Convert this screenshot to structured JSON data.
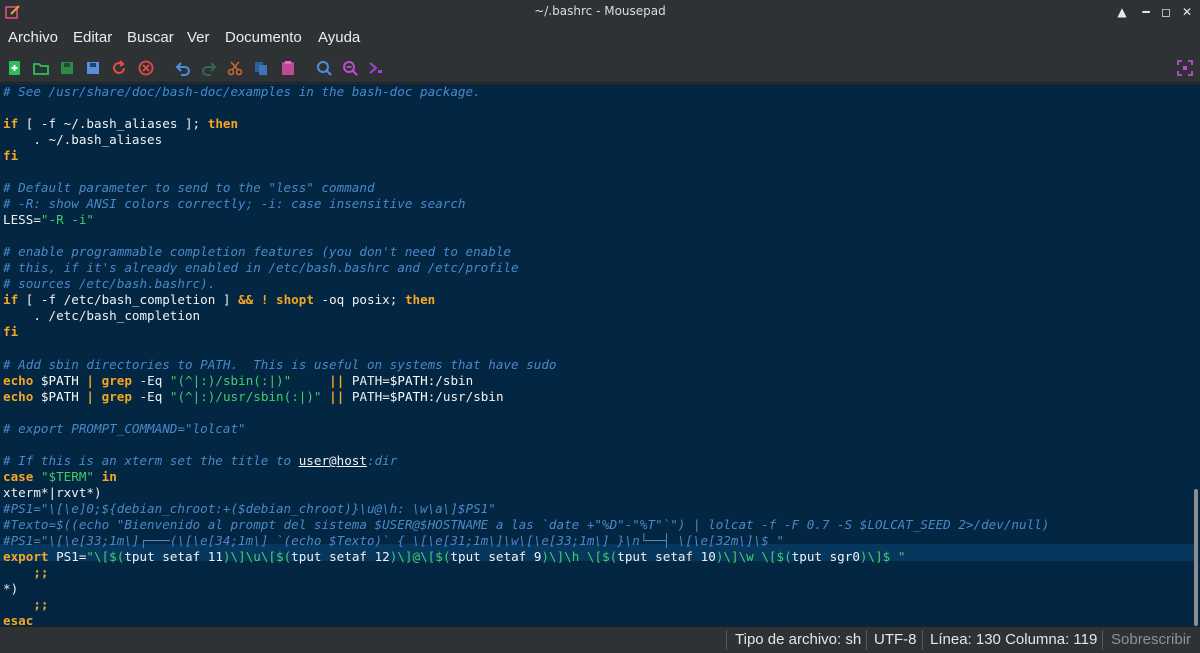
{
  "window": {
    "title": "~/.bashrc - Mousepad",
    "controls": [
      "minimize-up-icon",
      "minimize-icon",
      "maximize-icon",
      "close-icon"
    ]
  },
  "menu": [
    "Archivo",
    "Editar",
    "Buscar",
    "Ver",
    "Documento",
    "Ayuda"
  ],
  "toolbar": {
    "icons": [
      "new-document-icon",
      "open-file-icon",
      "save-icon",
      "save-as-icon",
      "reload-icon",
      "close-document-icon",
      "undo-icon",
      "redo-icon",
      "cut-icon",
      "copy-icon",
      "paste-icon",
      "search-icon",
      "search-replace-icon",
      "go-to-line-icon",
      "fullscreen-icon"
    ]
  },
  "colors": {
    "editor_bg": "#032642",
    "comment": "#4b88c8",
    "keyword": "#f5a623",
    "string": "#3fcf6a",
    "current_line": "#08375d"
  },
  "editor": {
    "lines": [
      {
        "tokens": [
          [
            "cm",
            "# See /usr/share/doc/bash-doc/examples in the bash-doc package."
          ]
        ]
      },
      {
        "tokens": []
      },
      {
        "tokens": [
          [
            "kw",
            "if"
          ],
          [
            "",
            " [ -f ~/.bash_aliases ]; "
          ],
          [
            "kw",
            "then"
          ]
        ]
      },
      {
        "tokens": [
          [
            "",
            "    . ~/.bash_aliases"
          ]
        ]
      },
      {
        "tokens": [
          [
            "kw",
            "fi"
          ]
        ]
      },
      {
        "tokens": []
      },
      {
        "tokens": [
          [
            "cm",
            "# Default parameter to send to the \"less\" command"
          ]
        ]
      },
      {
        "tokens": [
          [
            "cm",
            "# -R: show ANSI colors correctly; -i: case insensitive search"
          ]
        ]
      },
      {
        "tokens": [
          [
            "",
            "LESS="
          ],
          [
            "st",
            "\"-R -i\""
          ]
        ]
      },
      {
        "tokens": []
      },
      {
        "tokens": [
          [
            "cm",
            "# enable programmable completion features (you don't need to enable"
          ]
        ]
      },
      {
        "tokens": [
          [
            "cm",
            "# this, if it's already enabled in /etc/bash.bashrc and /etc/profile"
          ]
        ]
      },
      {
        "tokens": [
          [
            "cm",
            "# sources /etc/bash.bashrc)."
          ]
        ]
      },
      {
        "tokens": [
          [
            "kw",
            "if"
          ],
          [
            "",
            " [ -f /etc/bash_completion ] "
          ],
          [
            "kw",
            "&&"
          ],
          [
            "",
            " "
          ],
          [
            "kw",
            "!"
          ],
          [
            "",
            " "
          ],
          [
            "kw",
            "shopt"
          ],
          [
            "",
            " -oq posix; "
          ],
          [
            "kw",
            "then"
          ]
        ]
      },
      {
        "tokens": [
          [
            "",
            "    . /etc/bash_completion"
          ]
        ]
      },
      {
        "tokens": [
          [
            "kw",
            "fi"
          ]
        ]
      },
      {
        "tokens": []
      },
      {
        "tokens": [
          [
            "cm",
            "# Add sbin directories to PATH.  This is useful on systems that have sudo"
          ]
        ]
      },
      {
        "tokens": [
          [
            "kw",
            "echo"
          ],
          [
            "vr",
            " $PATH "
          ],
          [
            "kw",
            "|"
          ],
          [
            "",
            " "
          ],
          [
            "kw",
            "grep"
          ],
          [
            "",
            " -Eq "
          ],
          [
            "st",
            "\"(^|:)/sbin(:|)\""
          ],
          [
            "",
            "     "
          ],
          [
            "kw",
            "||"
          ],
          [
            "",
            " PATH="
          ],
          [
            "vr",
            "$PATH"
          ],
          [
            "",
            ":/sbin"
          ]
        ]
      },
      {
        "tokens": [
          [
            "kw",
            "echo"
          ],
          [
            "vr",
            " $PATH "
          ],
          [
            "kw",
            "|"
          ],
          [
            "",
            " "
          ],
          [
            "kw",
            "grep"
          ],
          [
            "",
            " -Eq "
          ],
          [
            "st",
            "\"(^|:)/usr/sbin(:|)\""
          ],
          [
            "",
            " "
          ],
          [
            "kw",
            "||"
          ],
          [
            "",
            " PATH="
          ],
          [
            "vr",
            "$PATH"
          ],
          [
            "",
            ":/usr/sbin"
          ]
        ]
      },
      {
        "tokens": []
      },
      {
        "tokens": [
          [
            "cm",
            "# export PROMPT_COMMAND=\"lolcat\""
          ]
        ]
      },
      {
        "tokens": []
      },
      {
        "tokens": [
          [
            "cm",
            "# If this is an xterm set the title to "
          ],
          [
            "ul",
            "user@host"
          ],
          [
            "cm",
            ":dir"
          ]
        ]
      },
      {
        "tokens": [
          [
            "kw",
            "case"
          ],
          [
            "",
            " "
          ],
          [
            "st",
            "\"$TERM\""
          ],
          [
            "",
            " "
          ],
          [
            "kw",
            "in"
          ]
        ]
      },
      {
        "tokens": [
          [
            "",
            "xterm*|rxvt*)"
          ]
        ]
      },
      {
        "tokens": [
          [
            "cm",
            "#PS1=\"\\[\\e]0;${debian_chroot:+($debian_chroot)}\\u@\\h: \\w\\a\\]$PS1\""
          ]
        ]
      },
      {
        "tokens": [
          [
            "cm",
            "#Texto=$((echo \"Bienvenido al prompt del sistema $USER@$HOSTNAME a las `date +\"%D\"-\"%T\"`\") | lolcat -f -F 0.7 -S $LOLCAT_SEED 2>/dev/null)"
          ]
        ]
      },
      {
        "tokens": [
          [
            "cm",
            "#PS1=\"\\[\\e[33;1m\\]┌───(\\[\\e[34;1m\\] `(echo $Texto)` { \\[\\e[31;1m\\]\\w\\[\\e[33;1m\\] }\\n└──┤ \\[\\e[32m\\]\\$ \""
          ]
        ]
      },
      {
        "tokens": [
          [
            "kw",
            "export"
          ],
          [
            "",
            " PS1="
          ],
          [
            "st",
            "\"\\[$("
          ],
          [
            "",
            "tput setaf 11"
          ],
          [
            "st",
            ")\\]\\u\\[$("
          ],
          [
            "",
            "tput setaf 12"
          ],
          [
            "st",
            ")\\]@\\[$("
          ],
          [
            "",
            "tput setaf 9"
          ],
          [
            "st",
            ")\\]\\h \\[$("
          ],
          [
            "",
            "tput setaf 10"
          ],
          [
            "st",
            ")\\]\\w \\[$("
          ],
          [
            "",
            "tput sgr0"
          ],
          [
            "st",
            ")\\]$ \""
          ]
        ]
      },
      {
        "tokens": [
          [
            "kw",
            "    ;;"
          ]
        ]
      },
      {
        "tokens": [
          [
            "",
            "*)"
          ]
        ]
      },
      {
        "tokens": [
          [
            "kw",
            "    ;;"
          ]
        ]
      },
      {
        "tokens": [
          [
            "kw",
            "esac"
          ]
        ]
      }
    ]
  },
  "status": {
    "filetype": "Tipo de archivo: sh",
    "encoding": "UTF-8",
    "position": "Línea: 130 Columna: 119",
    "mode": "Sobrescribir"
  }
}
